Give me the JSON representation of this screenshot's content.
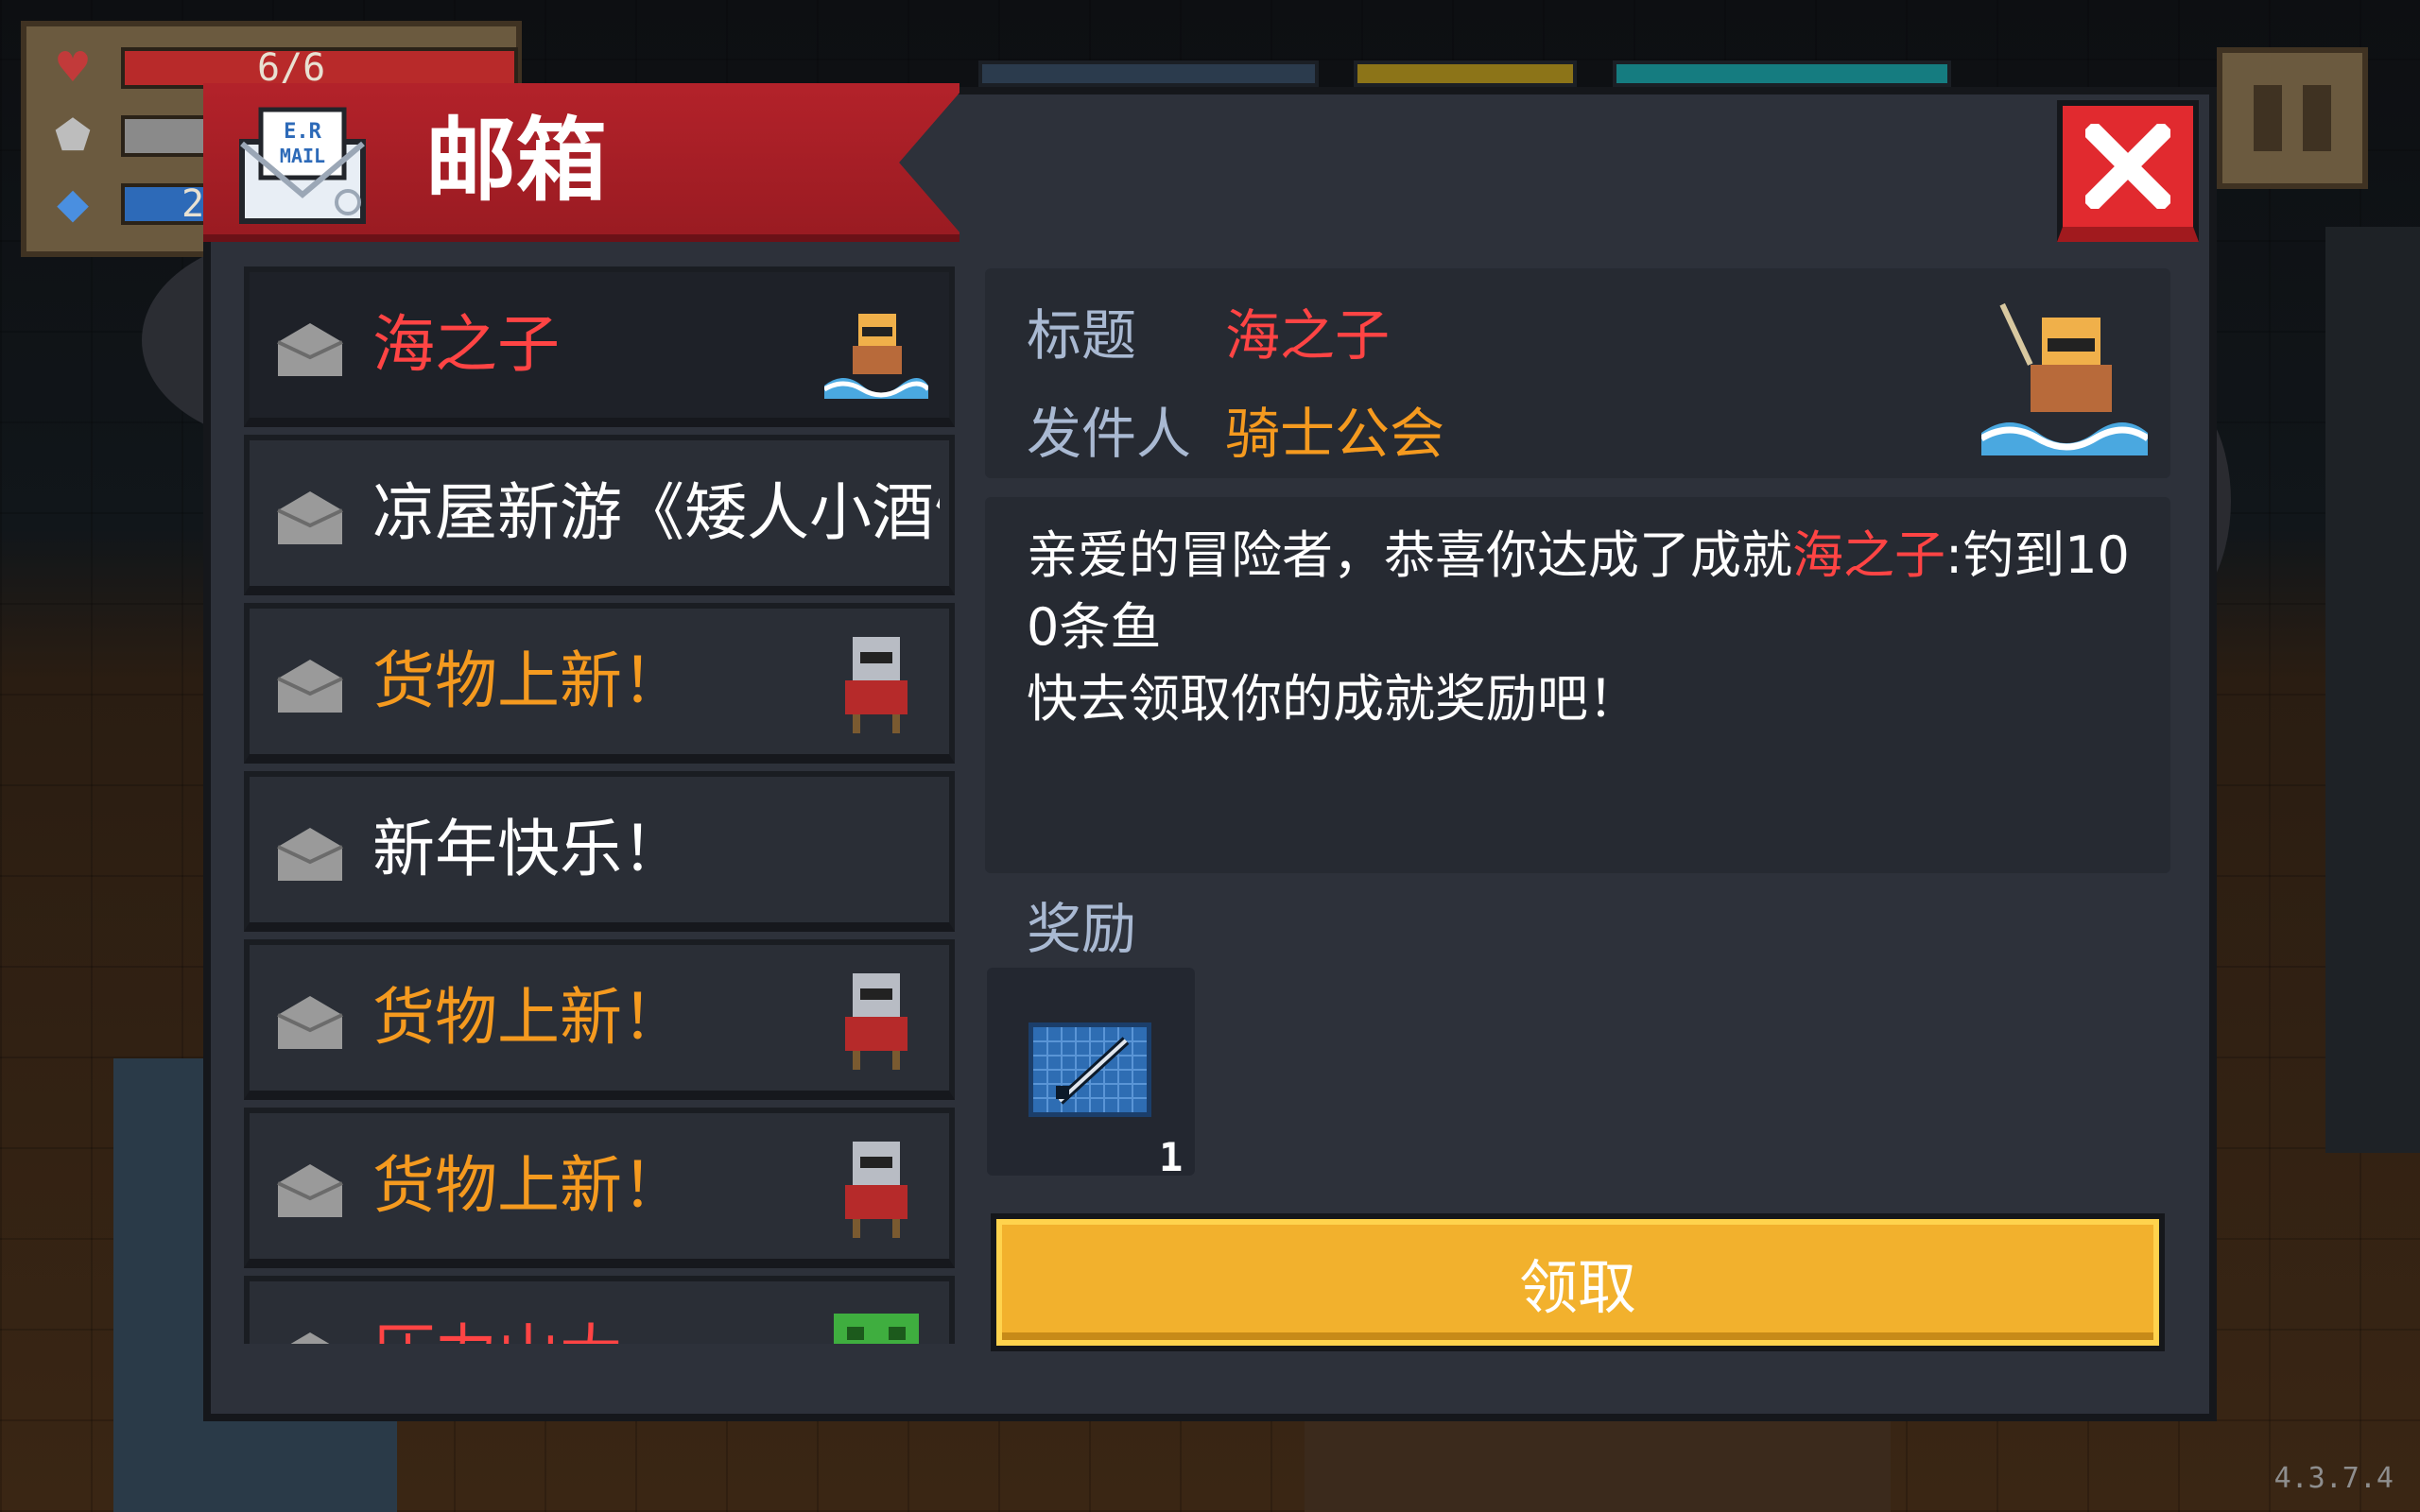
{
  "hud": {
    "hp_text": "6/6",
    "energy_text": "2",
    "hp_icon": "heart-icon",
    "armor_icon": "shield-icon",
    "energy_icon": "diamond-icon"
  },
  "dialog": {
    "title": "邮箱",
    "close_icon": "close-icon",
    "mail_icon_text": "E.R MAIL"
  },
  "mail_list": [
    {
      "label": "海之子",
      "color": "#ff4444",
      "selected": true,
      "thumb": "fisher-portrait"
    },
    {
      "label": "凉屋新游《矮人小酒馆》",
      "color": "#ffffff",
      "selected": false,
      "thumb": ""
    },
    {
      "label": "货物上新！",
      "color": "#f59a1f",
      "selected": false,
      "thumb": "merchant-portrait"
    },
    {
      "label": "新年快乐！",
      "color": "#ffffff",
      "selected": false,
      "thumb": ""
    },
    {
      "label": "货物上新！",
      "color": "#f59a1f",
      "selected": false,
      "thumb": "merchant-portrait"
    },
    {
      "label": "货物上新！",
      "color": "#f59a1f",
      "selected": false,
      "thumb": "merchant-portrait"
    },
    {
      "label": "压力山大",
      "color": "#ff4444",
      "selected": false,
      "thumb": "frog-portrait"
    }
  ],
  "detail": {
    "title_label": "标题",
    "title_value": "海之子",
    "sender_label": "发件人",
    "sender_value": "骑士公会",
    "body_before": "亲爱的冒险者，恭喜你达成了成就",
    "body_highlight": "海之子",
    "body_after": ":钓到100条鱼",
    "body_line2": "快去领取你的成就奖励吧！",
    "reward_label": "奖励",
    "reward_item": "fishing-rod-blueprint",
    "reward_count": "1",
    "claim_label": "领取"
  },
  "version": "4.3.7.4",
  "colors": {
    "banner": "#a01d24",
    "panel": "#2d313a",
    "claim": "#f2b12d",
    "red_text": "#ff4444",
    "orange_text": "#f59a1f",
    "label_text": "#a9b9d2"
  }
}
